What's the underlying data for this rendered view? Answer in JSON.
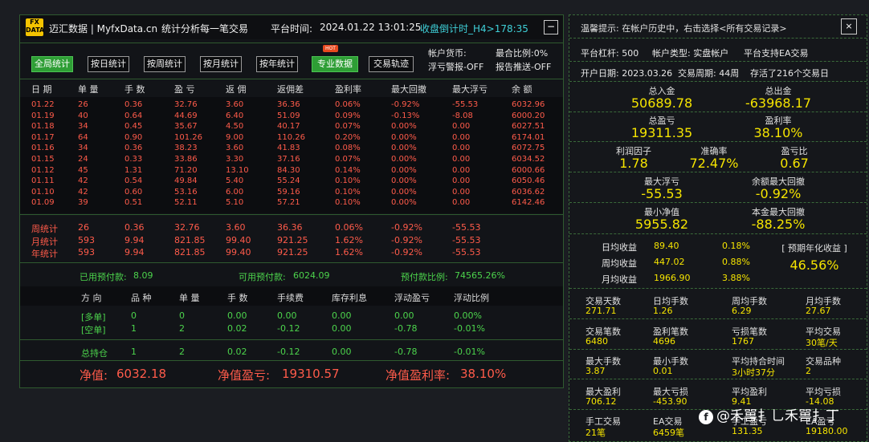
{
  "header": {
    "logo_top": "FX",
    "logo_bottom": "DATA",
    "app_name": "迈汇数据 | MyfxData.cn",
    "slogan": "统计分析每一笔交易",
    "platform_time_label": "平台时间:",
    "platform_time": "2024.01.22 13:01:25",
    "countdown": "收盘倒计时_H4>178:35",
    "minimize": "−"
  },
  "toolbar": {
    "buttons": [
      "全局统计",
      "按日统计",
      "按周统计",
      "按月统计",
      "按年统计",
      "专业数据",
      "交易轨迹"
    ],
    "hot_badge": "HOT",
    "account_currency": "帐户货币:",
    "max_ratio": "最合比例:0%",
    "float_alert": "浮亏警报-OFF",
    "report_push": "报告推送-OFF"
  },
  "daily_table": {
    "headers": [
      "日 期",
      "单 量",
      "手 数",
      "盈 亏",
      "返 佣",
      "返佣差",
      "盈利率",
      "最大回撤",
      "最大浮亏",
      "余 额"
    ],
    "rows": [
      [
        "01.22",
        "26",
        "0.36",
        "32.76",
        "3.60",
        "36.36",
        "0.06%",
        "-0.92%",
        "-55.53",
        "6032.96"
      ],
      [
        "01.19",
        "40",
        "0.64",
        "44.69",
        "6.40",
        "51.09",
        "0.09%",
        "-0.13%",
        "-8.08",
        "6000.20"
      ],
      [
        "01.18",
        "34",
        "0.45",
        "35.67",
        "4.50",
        "40.17",
        "0.07%",
        "0.00%",
        "0.00",
        "6027.51"
      ],
      [
        "01.17",
        "64",
        "0.90",
        "101.26",
        "9.00",
        "110.26",
        "0.20%",
        "0.00%",
        "0.00",
        "6174.01"
      ],
      [
        "01.16",
        "34",
        "0.36",
        "38.23",
        "3.60",
        "41.83",
        "0.08%",
        "0.00%",
        "0.00",
        "6072.75"
      ],
      [
        "01.15",
        "24",
        "0.33",
        "33.86",
        "3.30",
        "37.16",
        "0.07%",
        "0.00%",
        "0.00",
        "6034.52"
      ],
      [
        "01.12",
        "45",
        "1.31",
        "71.20",
        "13.10",
        "84.30",
        "0.14%",
        "0.00%",
        "0.00",
        "6000.66"
      ],
      [
        "01.11",
        "42",
        "0.54",
        "49.84",
        "5.40",
        "55.24",
        "0.10%",
        "0.00%",
        "0.00",
        "6050.46"
      ],
      [
        "01.10",
        "42",
        "0.60",
        "53.16",
        "6.00",
        "59.16",
        "0.10%",
        "0.00%",
        "0.00",
        "6036.62"
      ],
      [
        "01.09",
        "39",
        "0.51",
        "52.11",
        "5.10",
        "57.21",
        "0.10%",
        "0.00%",
        "0.00",
        "6142.46"
      ]
    ],
    "summary": [
      [
        "周统计",
        "26",
        "0.36",
        "32.76",
        "3.60",
        "36.36",
        "0.06%",
        "-0.92%",
        "-55.53"
      ],
      [
        "月统计",
        "593",
        "9.94",
        "821.85",
        "99.40",
        "921.25",
        "1.62%",
        "-0.92%",
        "-55.53"
      ],
      [
        "年统计",
        "593",
        "9.94",
        "821.85",
        "99.40",
        "921.25",
        "1.62%",
        "-0.92%",
        "-55.53"
      ]
    ]
  },
  "margin": {
    "used_label": "已用预付款:",
    "used": "8.09",
    "free_label": "可用预付款:",
    "free": "6024.09",
    "ratio_label": "预付款比例:",
    "ratio": "74565.26%"
  },
  "positions": {
    "headers": [
      "方 向",
      "品 种",
      "单 量",
      "手 数",
      "手续费",
      "库存利息",
      "浮动盈亏",
      "浮动比例"
    ],
    "rows": [
      [
        "[多单]",
        "0",
        "0",
        "0.00",
        "0.00",
        "0.00",
        "0.00",
        "0.00%"
      ],
      [
        "[空单]",
        "1",
        "2",
        "0.02",
        "-0.12",
        "0.00",
        "-0.78",
        "-0.01%"
      ]
    ],
    "total": [
      "总持仓",
      "1",
      "2",
      "0.02",
      "-0.12",
      "0.00",
      "-0.78",
      "-0.01%"
    ]
  },
  "footer": {
    "equity_label": "净值:",
    "equity": "6032.18",
    "equity_pl_label": "净值盈亏:",
    "equity_pl": "19310.57",
    "equity_rate_label": "净值盈利率:",
    "equity_rate": "38.10%"
  },
  "right": {
    "tip": "温馨提示: 在帐户历史中，右击选择<所有交易记录>",
    "close": "×",
    "leverage": "平台杠杆: 500",
    "account_type": "帐户类型: 实盘帐户",
    "ea_support": "平台支持EA交易",
    "open_date": "开户日期: 2023.03.26",
    "trade_weeks": "交易周期: 44周",
    "records": "存活了216个交易日",
    "total_deposit_label": "总入金",
    "total_deposit": "50689.78",
    "total_withdraw_label": "总出金",
    "total_withdraw": "-63968.17",
    "total_pl_label": "总盈亏",
    "total_pl": "19311.35",
    "profit_rate_label": "盈利率",
    "profit_rate": "38.10%",
    "profit_factor_label": "利润因子",
    "profit_factor": "1.78",
    "accuracy_label": "准确率",
    "accuracy": "72.47%",
    "pl_ratio_label": "盈亏比",
    "pl_ratio": "0.67",
    "max_float_label": "最大浮亏",
    "max_float": "-55.53",
    "max_dd_label": "余额最大回撤",
    "max_dd": "-0.92%",
    "min_equity_label": "最小净值",
    "min_equity": "5955.82",
    "equity_dd_label": "本金最大回撤",
    "equity_dd": "-88.25%",
    "daily_label": "日均收益",
    "daily": "89.40",
    "daily_pct": "0.18%",
    "weekly_label": "周均收益",
    "weekly": "447.02",
    "weekly_pct": "0.88%",
    "monthly_label": "月均收益",
    "monthly": "1966.90",
    "monthly_pct": "3.88%",
    "annual_label": "[ 预期年化收益 ]",
    "annual": "46.56%",
    "grid1": [
      [
        "交易天数",
        "271.71"
      ],
      [
        "日均手数",
        "1.26"
      ],
      [
        "周均手数",
        "6.29"
      ],
      [
        "月均手数",
        "27.67"
      ]
    ],
    "grid2": [
      [
        "交易笔数",
        "6480"
      ],
      [
        "盈利笔数",
        "4696"
      ],
      [
        "亏损笔数",
        "1767"
      ],
      [
        "平均交易",
        "30笔/天"
      ]
    ],
    "grid3": [
      [
        "最大手数",
        "3.87"
      ],
      [
        "最小手数",
        "0.01"
      ],
      [
        "平均持合时间",
        "3小时37分"
      ],
      [
        "交易品种",
        "2"
      ]
    ],
    "grid4": [
      [
        "最大盈利",
        "706.12"
      ],
      [
        "最大亏损",
        "-453.90"
      ],
      [
        "平均盈利",
        "9.41"
      ],
      [
        "平均亏损",
        "-14.08"
      ]
    ],
    "grid5": [
      [
        "手工交易",
        "21笔"
      ],
      [
        "EA交易",
        "6459笔"
      ],
      [
        "手工盈亏",
        "131.35"
      ],
      [
        "EA盈亏",
        "19180.00"
      ]
    ]
  },
  "watermark": {
    "icon": "f",
    "text": "@禾嘼扌乚禾嘼扌丁"
  }
}
